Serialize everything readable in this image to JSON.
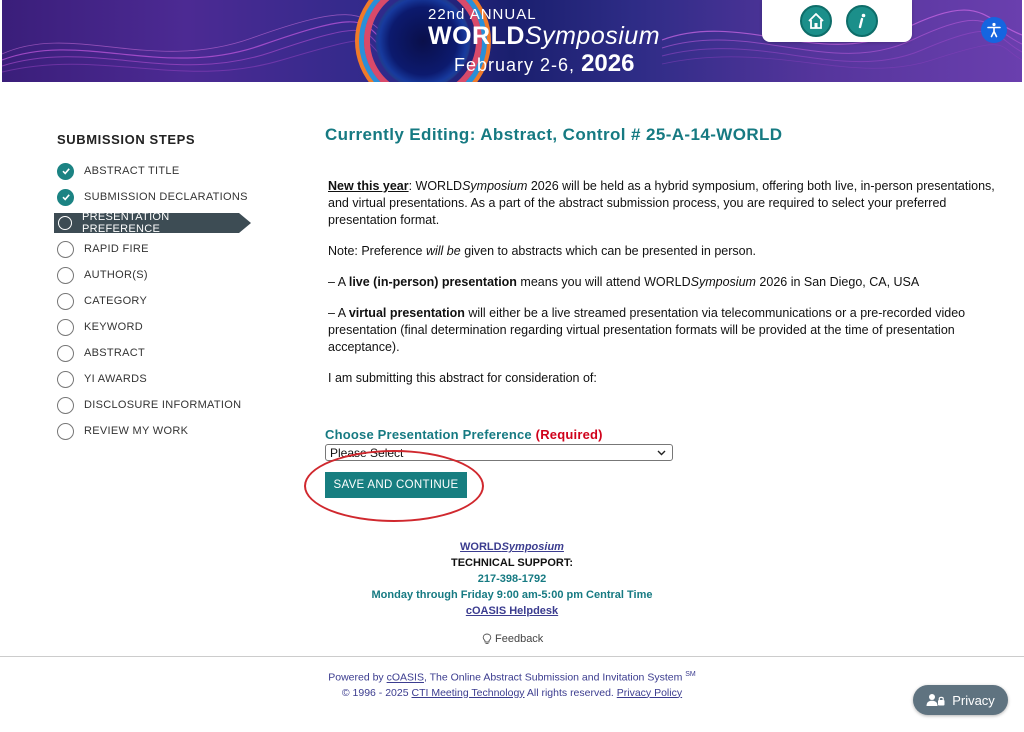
{
  "banner": {
    "annual": "22nd ANNUAL",
    "world": "WORLD",
    "symposium": "Symposium",
    "dates_text": "February 2-6,",
    "year": "2026",
    "colors": {
      "teal": "#1b8f8a",
      "accessibility": "#1565e0"
    },
    "icons": [
      "home-icon",
      "info-icon",
      "accessibility-icon"
    ]
  },
  "sidebar": {
    "title": "SUBMISSION STEPS",
    "steps": [
      {
        "label": "ABSTRACT TITLE",
        "state": "done"
      },
      {
        "label": "SUBMISSION DECLARATIONS",
        "state": "done"
      },
      {
        "label": "PRESENTATION PREFERENCE",
        "state": "active"
      },
      {
        "label": "RAPID FIRE",
        "state": "pending"
      },
      {
        "label": "AUTHOR(S)",
        "state": "pending"
      },
      {
        "label": "CATEGORY",
        "state": "pending"
      },
      {
        "label": "KEYWORD",
        "state": "pending"
      },
      {
        "label": "ABSTRACT",
        "state": "pending"
      },
      {
        "label": "YI AWARDS",
        "state": "pending"
      },
      {
        "label": "DISCLOSURE INFORMATION",
        "state": "pending"
      },
      {
        "label": "REVIEW MY WORK",
        "state": "pending"
      }
    ]
  },
  "main": {
    "title": "Currently Editing: Abstract,  Control # 25-A-14-WORLD",
    "p1": {
      "lead": "New this year",
      "a": ": WORLD",
      "sym": "Symposium",
      "b": " 2026 will be held as a hybrid symposium, offering both live, in-person presentations, and virtual presentations. As a part of the abstract submission process, you are required to select your preferred presentation format."
    },
    "p2": {
      "a": "Note: Preference ",
      "em": "will be",
      "b": " given to abstracts which can be presented in person."
    },
    "p3": {
      "a": "– A ",
      "strong": "live (in-person) presentation",
      "b": " means you will attend WORLD",
      "sym": "Symposium",
      "c": " 2026 in San Diego, CA, USA"
    },
    "p4": {
      "a": "– A ",
      "strong": "virtual presentation",
      "b": " will either be a live streamed presentation via telecommunications or a pre-recorded video presentation (final determination regarding virtual presentation formats will be provided at the time of presentation acceptance)."
    },
    "p5": "I am submitting this abstract for consideration of:",
    "pref_label": "Choose Presentation Preference",
    "pref_required": "(Required)",
    "pref_selected": "Please Select",
    "save_label": "SAVE AND CONTINUE",
    "highlight_color": "#d0282e"
  },
  "support": {
    "world": "WORLD",
    "sym": "Symposium",
    "heading": "TECHNICAL SUPPORT:",
    "phone": "217-398-1792",
    "hours": "Monday through Friday 9:00 am-5:00 pm Central Time",
    "helpdesk": "cOASIS Helpdesk",
    "feedback": "Feedback"
  },
  "footer": {
    "powered_a": "Powered by ",
    "coasis": "cOASIS",
    "powered_b": ", The Online Abstract Submission and Invitation System ",
    "sm": "SM",
    "copy_a": "© 1996 - 2025 ",
    "cti": "CTI Meeting Technology",
    "copy_b": "  All rights reserved. ",
    "privacy_policy": "Privacy Policy"
  },
  "privacy_button": "Privacy"
}
